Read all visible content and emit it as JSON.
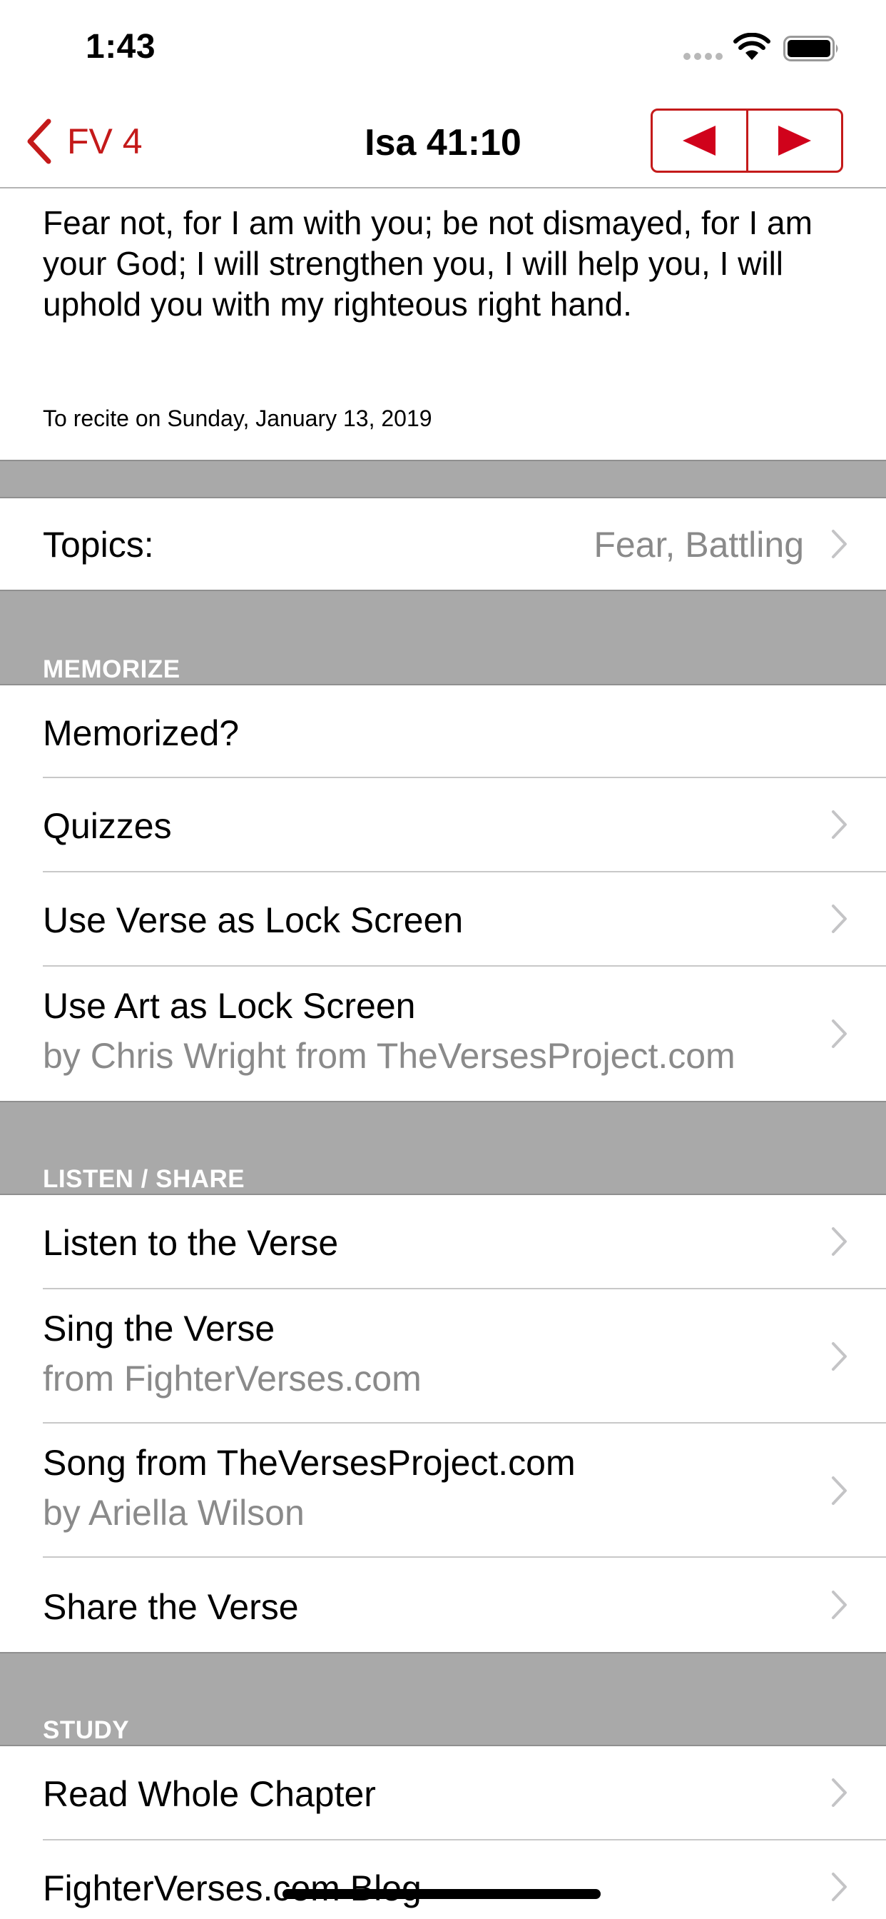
{
  "status": {
    "time": "1:43"
  },
  "nav": {
    "back_label": "FV 4",
    "title": "Isa 41:10",
    "prev_icon": "triangle-left-icon",
    "next_icon": "triangle-right-icon"
  },
  "verse": {
    "text": "Fear not, for I am with you; be not dismayed, for I am your God; I will strengthen you, I will help you, I will uphold you with my righteous right hand.",
    "recite": "To recite on Sunday, January 13, 2019"
  },
  "topics": {
    "label": "Topics:",
    "value": "Fear, Battling"
  },
  "sections": {
    "memorize": {
      "header": "MEMORIZE",
      "items": [
        {
          "title": "Memorized?"
        },
        {
          "title": "Quizzes"
        },
        {
          "title": "Use Verse as Lock Screen"
        },
        {
          "title": "Use Art as Lock Screen",
          "subtitle": "by Chris Wright from TheVersesProject.com"
        }
      ]
    },
    "listen_share": {
      "header": "LISTEN / SHARE",
      "items": [
        {
          "title": "Listen to the Verse"
        },
        {
          "title": "Sing the Verse",
          "subtitle": "from FighterVerses.com"
        },
        {
          "title": "Song from TheVersesProject.com",
          "subtitle": "by Ariella Wilson"
        },
        {
          "title": "Share the Verse"
        }
      ]
    },
    "study": {
      "header": "STUDY",
      "items": [
        {
          "title": "Read Whole Chapter"
        },
        {
          "title": "FighterVerses.com Blog"
        }
      ]
    }
  },
  "colors": {
    "accent": "#c41a1a",
    "band": "#a9a9a9",
    "secondary_text": "#8a8a8a"
  }
}
